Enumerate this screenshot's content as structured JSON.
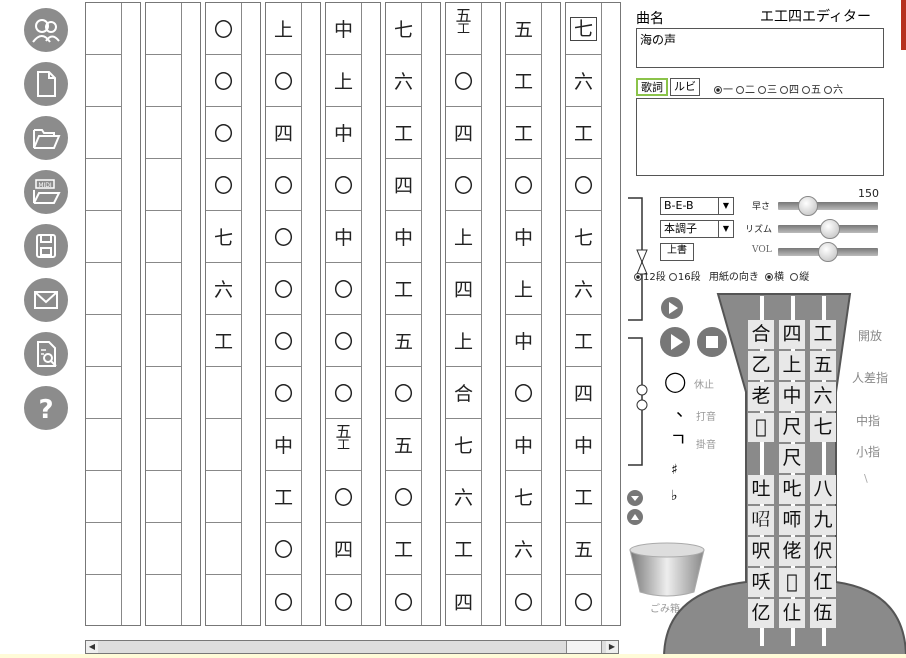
{
  "toolbar": {
    "buttons": [
      {
        "name": "user-group-icon"
      },
      {
        "name": "new-file-icon"
      },
      {
        "name": "open-folder-icon"
      },
      {
        "name": "midi-open-icon",
        "label": "MIDI"
      },
      {
        "name": "save-icon"
      },
      {
        "name": "mail-icon"
      },
      {
        "name": "preview-icon"
      },
      {
        "name": "help-icon"
      }
    ]
  },
  "score": {
    "columns": [
      [
        "",
        "",
        "",
        "",
        "",
        "",
        "",
        "",
        "",
        "",
        "",
        ""
      ],
      [
        "",
        "",
        "",
        "",
        "",
        "",
        "",
        "",
        "",
        "",
        "",
        ""
      ],
      [
        "〇",
        "〇",
        "〇",
        "〇",
        "七",
        "六",
        "工",
        "",
        "",
        "",
        "",
        ""
      ],
      [
        "上",
        "〇",
        "四",
        "〇",
        "〇",
        "〇",
        "〇",
        "〇",
        "中",
        "工",
        "〇",
        "〇"
      ],
      [
        "中",
        "上",
        "中",
        "〇",
        "中",
        "〇",
        "〇",
        "〇",
        "五工",
        "〇",
        "四",
        "〇"
      ],
      [
        "七",
        "六",
        "工",
        "四",
        "中",
        "工",
        "五",
        "〇",
        "五",
        "〇",
        "工",
        "〇"
      ],
      [
        "五工",
        "〇",
        "四",
        "〇",
        "上",
        "四",
        "上",
        "合",
        "七",
        "六",
        "工",
        "四"
      ],
      [
        "五",
        "工",
        "工",
        "〇",
        "中",
        "上",
        "中",
        "〇",
        "中",
        "七",
        "六",
        "〇"
      ],
      [
        "七",
        "六",
        "工",
        "〇",
        "七",
        "六",
        "工",
        "四",
        "中",
        "工",
        "五",
        "〇"
      ]
    ]
  },
  "panel": {
    "title_label": "曲名",
    "app_name": "エ工四エディター",
    "song_title": "海の声",
    "tab_lyrics": "歌詞",
    "tab_ruby": "ルビ",
    "verse_options": [
      "一",
      "二",
      "三",
      "四",
      "五",
      "六"
    ],
    "verse_selected": 0,
    "key_select": "B-E-B",
    "mode_select": "本調子",
    "overwrite_button": "上書",
    "speed_label": "早さ",
    "speed_value": "150",
    "rhythm_label": "リズム",
    "vol_label": "VOL",
    "rows_12": "12段",
    "rows_16": "16段",
    "orientation_label": "用紙の向き",
    "orientation_landscape": "横",
    "orientation_portrait": "縦",
    "rest_label": "休止",
    "strike_label": "打音",
    "hold_label": "掛音",
    "sharp": "♯",
    "flat": "♭",
    "trash_label": "ごみ箱",
    "finger_open": "開放",
    "finger_index": "人差指",
    "finger_middle": "中指",
    "finger_little": "小指",
    "finger_extra": "\\"
  },
  "flute": {
    "rows": [
      [
        "合",
        "四",
        "工"
      ],
      [
        "乙",
        "上",
        "五"
      ],
      [
        "老",
        "中",
        "六"
      ],
      [
        "𠯮",
        "尺",
        "七"
      ],
      [
        "",
        "尺",
        ""
      ],
      [
        "吐",
        "𠮟",
        "八"
      ],
      [
        "𠰉",
        "𠯗",
        "九"
      ],
      [
        "呎",
        "佬",
        "伬"
      ],
      [
        "㕭",
        "𫝀",
        "仜"
      ],
      [
        "亿",
        "仩",
        "伍"
      ]
    ]
  }
}
